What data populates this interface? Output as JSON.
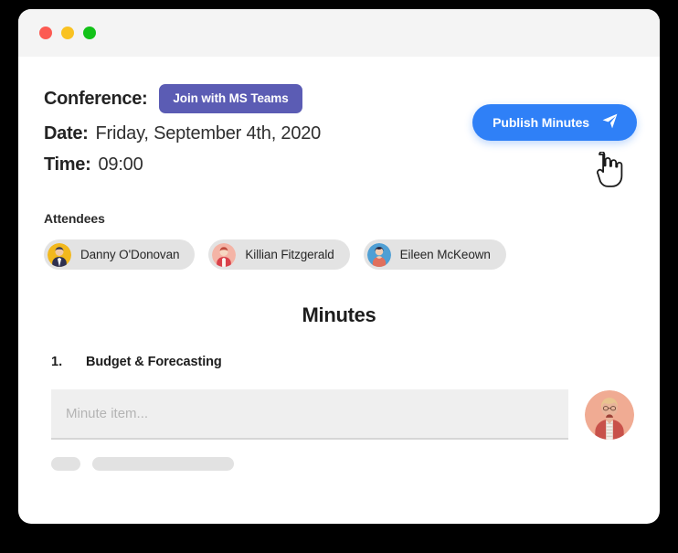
{
  "window": {
    "traffic_lights": [
      {
        "name": "close",
        "color": "#fc5a52"
      },
      {
        "name": "minimize",
        "color": "#f9c222"
      },
      {
        "name": "maximize",
        "color": "#13c219"
      }
    ]
  },
  "header": {
    "conference_label": "Conference:",
    "teams_button_label": "Join with MS Teams",
    "date_label": "Date:",
    "date_value": "Friday, September 4th, 2020",
    "time_label": "Time:",
    "time_value": "09:00",
    "publish_button_label": "Publish Minutes",
    "publish_icon": "paper-plane-icon",
    "cursor": "hand-pointer-cursor"
  },
  "attendees": {
    "title": "Attendees",
    "people": [
      {
        "name": "Danny O'Donovan",
        "avatar_bg": "#f2b81d",
        "avatar_hair": "#3a3a52",
        "avatar_body": "#2f3150",
        "avatar_skin": "#f1c9a5"
      },
      {
        "name": "Killian Fitzgerald",
        "avatar_bg": "#f4b4a6",
        "avatar_hair": "#c04a3c",
        "avatar_body": "#d9414a",
        "avatar_skin": "#f6d7c2"
      },
      {
        "name": "Eileen McKeown",
        "avatar_bg": "#4f9fd4",
        "avatar_hair": "#26223a",
        "avatar_body": "#e0705d",
        "avatar_skin": "#f3cdb2"
      }
    ]
  },
  "minutes": {
    "heading": "Minutes",
    "items": [
      {
        "number": "1.",
        "title": "Budget & Forecasting"
      }
    ],
    "input_placeholder": "Minute item...",
    "input_value": "",
    "composer_avatar": {
      "name": "composer-avatar",
      "bg": "#f0ab93",
      "hair": "#e8c48f",
      "skin": "#e8b49a",
      "jacket": "#c8514a",
      "shirt": "#f4f0ea"
    }
  },
  "colors": {
    "accent_blue": "#2f80f7",
    "teams_purple": "#5b5cb4",
    "chip_gray": "#e3e3e3",
    "input_gray": "#efefef",
    "skeleton_gray": "#e2e2e2"
  }
}
